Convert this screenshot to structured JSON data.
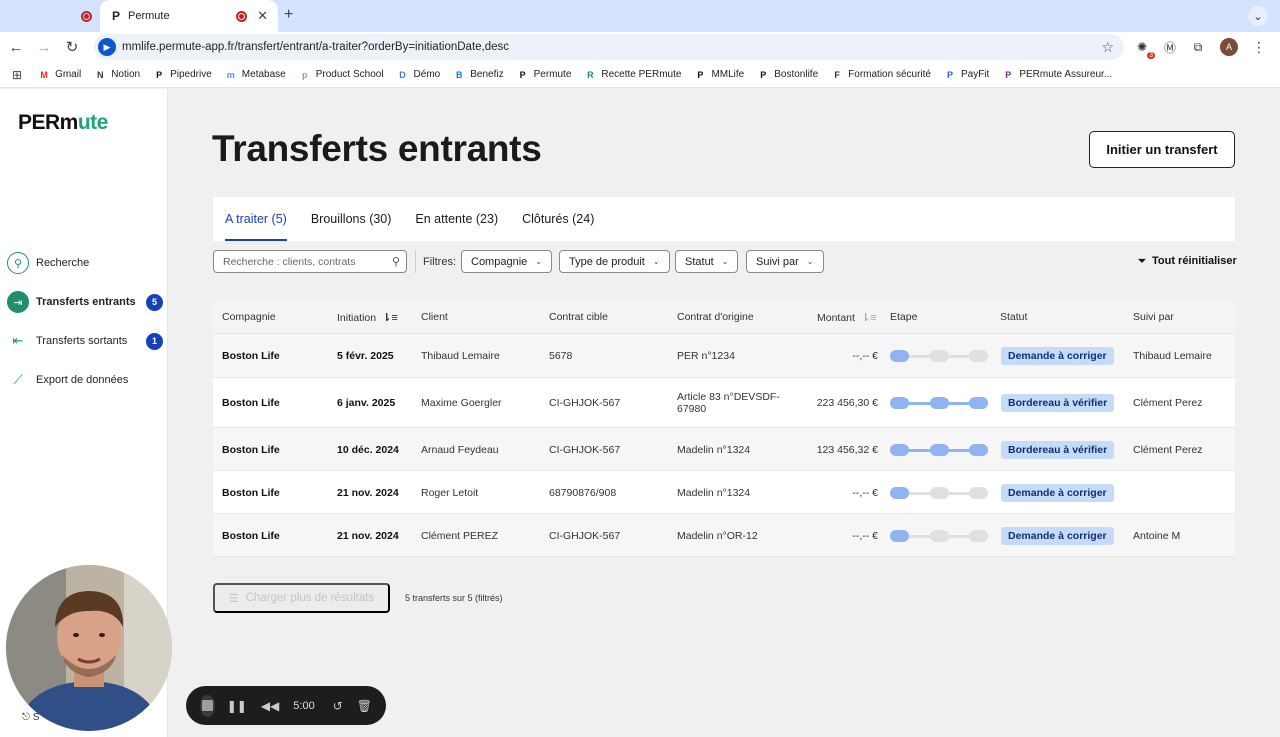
{
  "browser": {
    "tabs": [
      {
        "title": ""
      },
      {
        "title": "Permute",
        "favicon": "P"
      }
    ],
    "new_tab": "+",
    "url": "mmlife.permute-app.fr/transfert/entrant/a-traiter?orderBy=initiationDate,desc",
    "extension_badge": "3",
    "profile_initial": "A",
    "bookmarks": [
      {
        "label": "Gmail",
        "icon": "M"
      },
      {
        "label": "Notion",
        "icon": "N"
      },
      {
        "label": "Pipedrive",
        "icon": "P"
      },
      {
        "label": "Metabase",
        "icon": "m"
      },
      {
        "label": "Product School",
        "icon": "p"
      },
      {
        "label": "Démo",
        "icon": "D"
      },
      {
        "label": "Benefiz",
        "icon": "B"
      },
      {
        "label": "Permute",
        "icon": "P"
      },
      {
        "label": "Recette PERmute",
        "icon": "R"
      },
      {
        "label": "MMLife",
        "icon": "P"
      },
      {
        "label": "Bostonlife",
        "icon": "P"
      },
      {
        "label": "Formation sécurité",
        "icon": "F"
      },
      {
        "label": "PayFit",
        "icon": "P"
      },
      {
        "label": "PERmute Assureur...",
        "icon": "P"
      }
    ]
  },
  "sidebar": {
    "logo": {
      "part1": "PERm",
      "part2": "ute"
    },
    "items": [
      {
        "label": "Recherche",
        "icon": "search-icon"
      },
      {
        "label": "Transferts entrants",
        "icon": "arrow-in-icon",
        "count": "5"
      },
      {
        "label": "Transferts sortants",
        "icon": "arrow-out-icon",
        "count": "1"
      },
      {
        "label": "Export de données",
        "icon": "chart-line-icon"
      }
    ],
    "footer_label": "S"
  },
  "main": {
    "title": "Transferts entrants",
    "initiate_button": "Initier un transfert",
    "tabs": [
      {
        "label": "A traiter (5)"
      },
      {
        "label": "Brouillons (30)"
      },
      {
        "label": "En attente (23)"
      },
      {
        "label": "Clôturés (24)"
      }
    ],
    "search_placeholder": "Recherche : clients, contrats",
    "filters_label": "Filtres:",
    "filters": [
      {
        "label": "Compagnie"
      },
      {
        "label": "Type de produit"
      },
      {
        "label": "Statut"
      },
      {
        "label": "Suivi par"
      }
    ],
    "reset_label": "Tout réinitialiser",
    "table": {
      "columns": [
        "Compagnie",
        "Initiation",
        "Client",
        "Contrat cible",
        "Contrat d'origine",
        "Montant",
        "Etape",
        "Statut",
        "Suivi par"
      ],
      "rows": [
        {
          "company": "Boston Life",
          "date": "5 févr. 2025",
          "client": "Thibaud Lemaire",
          "target": "5678",
          "origin": "PER n°1234",
          "amount": "--,-- €",
          "step": 1,
          "status": "Demande à corriger",
          "owner": "Thibaud Lemaire"
        },
        {
          "company": "Boston Life",
          "date": "6 janv. 2025",
          "client": "Maxime Goergler",
          "target": "CI-GHJOK-567",
          "origin": "Article 83 n°DEVSDF-67980",
          "amount": "223 456,30 €",
          "step": 3,
          "status": "Bordereau à vérifier",
          "owner": "Clément Perez"
        },
        {
          "company": "Boston Life",
          "date": "10 déc. 2024",
          "client": "Arnaud Feydeau",
          "target": "CI-GHJOK-567",
          "origin": "Madelin n°1324",
          "amount": "123 456,32 €",
          "step": 3,
          "status": "Bordereau à vérifier",
          "owner": "Clément Perez"
        },
        {
          "company": "Boston Life",
          "date": "21 nov. 2024",
          "client": "Roger Letoit",
          "target": "68790876/908",
          "origin": "Madelin n°1324",
          "amount": "--,-- €",
          "step": 1,
          "status": "Demande à corriger",
          "owner": ""
        },
        {
          "company": "Boston Life",
          "date": "21 nov. 2024",
          "client": "Clément PEREZ",
          "target": "CI-GHJOK-567",
          "origin": "Madelin n°OR-12",
          "amount": "--,-- €",
          "step": 1,
          "status": "Demande à corriger",
          "owner": "Antoine M"
        }
      ],
      "total_steps": 3
    },
    "load_more": "Charger plus de résultats",
    "result_count": "5 transferts sur 5 (filtrés)"
  },
  "recorder": {
    "time": "5:00"
  },
  "colors": {
    "accent": "#1642b8",
    "brand_green": "#1f8f6a",
    "badge_bg": "#c6dbf8",
    "step_on": "#8fb4ef"
  }
}
